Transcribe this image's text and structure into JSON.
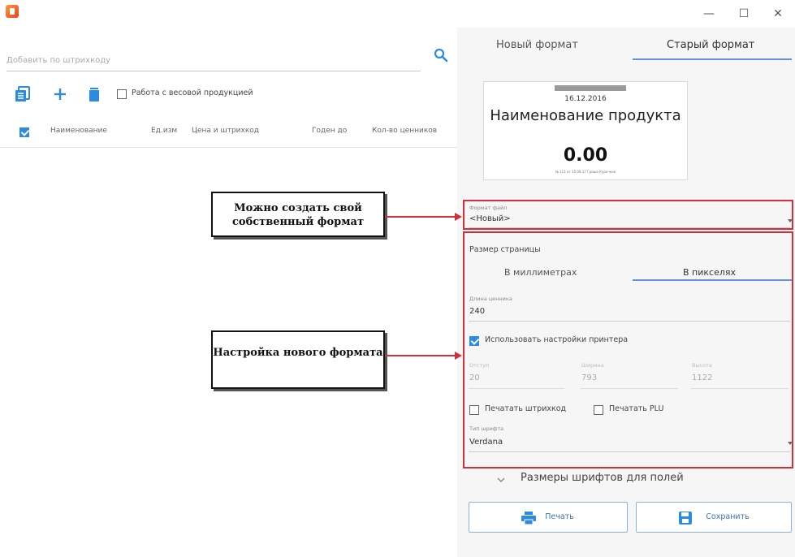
{
  "window": {
    "controls": {
      "minimize": "—",
      "maximize": "☐",
      "close": "✕"
    }
  },
  "left_panel": {
    "search": {
      "placeholder": "Добавить по штрихкоду"
    },
    "toolbar": {
      "weighted_label": "Работа с весовой продукцией"
    },
    "table_headers": [
      "Наименование",
      "Ед.изм",
      "Цена и штрихкод",
      "Годен до",
      "Кол-во ценников"
    ]
  },
  "right_panel": {
    "tabs": [
      "Новый формат",
      "Старый формат"
    ],
    "preview": {
      "date": "16.12.2016",
      "name": "Наименование продукта",
      "price": "0.00",
      "fine_print": "№ 111 от 15.08.17 Гриша Курочкин"
    },
    "format_file": {
      "label": "Формат файл",
      "value": "<Новый>"
    },
    "page_size_label": "Размер страницы",
    "unit_tabs": [
      "В миллиметрах",
      "В пикселях"
    ],
    "tag_length": {
      "label": "Длина ценника",
      "value": "240"
    },
    "use_printer_label": "Использовать настройки принтера",
    "printer_fields": [
      {
        "label": "Отступ",
        "value": "20"
      },
      {
        "label": "Ширина",
        "value": "793"
      },
      {
        "label": "Высота",
        "value": "1122"
      }
    ],
    "print_barcode_label": "Печатать штрихкод",
    "print_plu_label": "Печатать PLU",
    "font_type": {
      "label": "Тип шрифта",
      "value": "Verdana"
    },
    "font_sizes_label": "Размеры шрифтов для полей",
    "buttons": {
      "print": "Печать",
      "save": "Сохранить"
    }
  },
  "annotations": {
    "callout_1": "Можно создать свой собственный формат",
    "callout_2": "Настройка нового формата"
  },
  "colors": {
    "accent": "#2a8be0",
    "annotation_red": "#d32f3a",
    "tab_underline": "#6b8fd3"
  }
}
